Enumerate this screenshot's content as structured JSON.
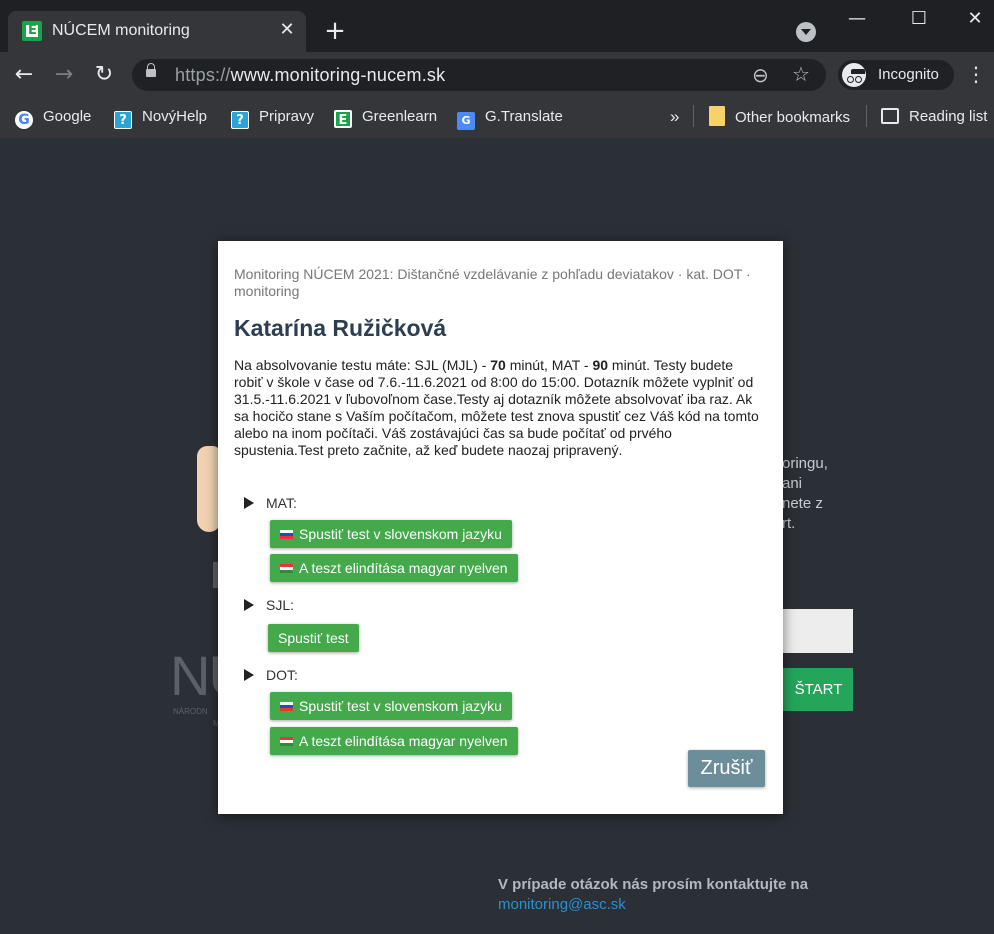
{
  "browser": {
    "tab_title": "NÚCEM monitoring",
    "tab_favicon": "E",
    "new_tab": "+",
    "url_scheme": "https://",
    "url_host": "www.monitoring-nucem.sk",
    "incognito_label": "Incognito",
    "window_controls": {
      "minimize": "—",
      "maximize": "☐",
      "close": "✕"
    },
    "bookmarks": [
      {
        "label": "Google",
        "icon": "google-icon"
      },
      {
        "label": "NovýHelp",
        "icon": "help-icon"
      },
      {
        "label": "Pripravy",
        "icon": "help-icon"
      },
      {
        "label": "Greenlearn",
        "icon": "greenlearn-icon"
      },
      {
        "label": "G.Translate",
        "icon": "translate-icon"
      }
    ],
    "more_bookmarks": "»",
    "other_bookmarks": "Other bookmarks",
    "reading_list": "Reading list"
  },
  "background": {
    "side_text_lines": [
      "oringu,",
      "ani",
      "nete z",
      "rt."
    ],
    "start_button": "ŠTART",
    "logo": "NU",
    "logo_sub": "NÁRODN",
    "logo_sub2": "M",
    "contact_text": "V prípade otázok nás prosím kontaktujte na",
    "contact_email": "monitoring@asc.sk"
  },
  "modal": {
    "subtitle": "Monitoring NÚCEM 2021: Dištančné vzdelávanie z pohľadu deviatakov · kat. DOT · monitoring",
    "student_name": "Katarína Ružičková",
    "description_intro": "Na absolvovanie testu máte: SJL (MJL) - ",
    "sjl_minutes": "70",
    "mid1": " minút, MAT - ",
    "mat_minutes": "90",
    "description_rest": " minút. Testy budete robiť v škole v čase od 7.6.-11.6.2021 od 8:00 do 15:00. Dotazník môžete vyplniť od 31.5.-11.6.2021 v ľubovoľnom čase.Testy aj dotazník môžete absolvovať iba raz. Ak sa hocičo stane s Vaším počítačom, môžete test znova spustiť cez Váš kód na tomto alebo na inom počítači. Váš zostávajúci čas sa bude počítať od prvého spustenia.Test preto začnite, až keď budete naozaj pripravený.",
    "sections": {
      "mat": {
        "label": "MAT:",
        "btn_sk": "Spustiť test v slovenskom jazyku",
        "btn_hu": "A teszt elindítása magyar nyelven"
      },
      "sjl": {
        "label": "SJL:",
        "btn": "Spustiť test"
      },
      "dot": {
        "label": "DOT:",
        "btn_sk": "Spustiť test v slovenskom jazyku",
        "btn_hu": "A teszt elindítása magyar nyelven"
      }
    },
    "cancel": "Zrušiť"
  },
  "colors": {
    "accent_green": "#43a94a",
    "cancel_gray": "#6b8e9a",
    "name_color": "#2c3e50",
    "page_bg": "#2b2f36"
  }
}
